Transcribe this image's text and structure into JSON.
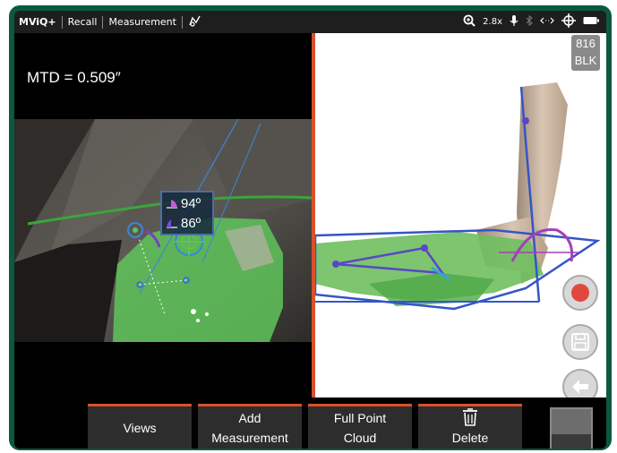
{
  "topbar": {
    "brand": "MViQ+",
    "mode": "Recall",
    "section": "Measurement",
    "zoom": "2.8x",
    "icons": [
      "annotate-icon",
      "zoom-icon",
      "microphone-icon",
      "bluetooth-icon",
      "link-icon",
      "crosshair-icon",
      "battery-icon"
    ]
  },
  "measurement": {
    "mtd": "MTD = 0.509″",
    "angle1": "94º",
    "angle2": "86º"
  },
  "view3d": {
    "badge_line1": "816",
    "badge_line2": "BLK",
    "side_buttons": [
      "record-icon",
      "save-icon",
      "back-arrow-icon"
    ]
  },
  "toolbar": {
    "views": "Views",
    "add_line1": "Add",
    "add_line2": "Measurement",
    "fpc_line1": "Full Point",
    "fpc_line2": "Cloud",
    "delete": "Delete"
  },
  "colors": {
    "accent": "#d9512c",
    "bezel": "#0b5a3d",
    "overlay_green": "#5fc45a",
    "measure_blue": "#3455c8"
  }
}
